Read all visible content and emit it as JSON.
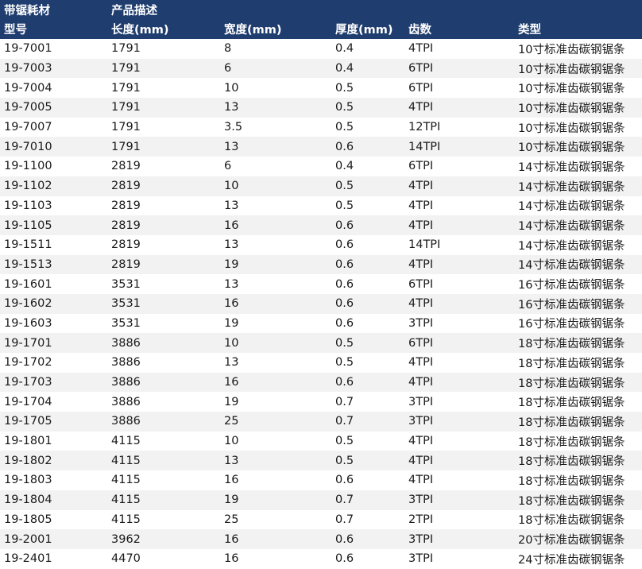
{
  "colors": {
    "header_bg": "#1f3d6e",
    "header_text": "#ffffff",
    "stripe": "#f2f2f2"
  },
  "table": {
    "group_header": {
      "col1": "带锯耗材",
      "col2": "产品描述"
    },
    "headers": [
      "型号",
      "长度(mm)",
      "宽度(mm)",
      "厚度(mm)",
      "齿数",
      "类型"
    ],
    "rows": [
      [
        "19-7001",
        "1791",
        "8",
        "0.4",
        "4TPI",
        "10寸标准齿碳钢锯条"
      ],
      [
        "19-7003",
        "1791",
        "6",
        "0.4",
        "6TPI",
        "10寸标准齿碳钢锯条"
      ],
      [
        "19-7004",
        "1791",
        "10",
        "0.5",
        "6TPI",
        "10寸标准齿碳钢锯条"
      ],
      [
        "19-7005",
        "1791",
        "13",
        "0.5",
        "4TPI",
        "10寸标准齿碳钢锯条"
      ],
      [
        "19-7007",
        "1791",
        "3.5",
        "0.5",
        "12TPI",
        "10寸标准齿碳钢锯条"
      ],
      [
        "19-7010",
        "1791",
        "13",
        "0.6",
        "14TPI",
        "10寸标准齿碳钢锯条"
      ],
      [
        "19-1100",
        "2819",
        "6",
        "0.4",
        "6TPI",
        "14寸标准齿碳钢锯条"
      ],
      [
        "19-1102",
        "2819",
        "10",
        "0.5",
        "4TPI",
        "14寸标准齿碳钢锯条"
      ],
      [
        "19-1103",
        "2819",
        "13",
        "0.5",
        "4TPI",
        "14寸标准齿碳钢锯条"
      ],
      [
        "19-1105",
        "2819",
        "16",
        "0.6",
        "4TPI",
        "14寸标准齿碳钢锯条"
      ],
      [
        "19-1511",
        "2819",
        "13",
        "0.6",
        "14TPI",
        "14寸标准齿碳钢锯条"
      ],
      [
        "19-1513",
        "2819",
        "19",
        "0.6",
        "4TPI",
        "14寸标准齿碳钢锯条"
      ],
      [
        "19-1601",
        "3531",
        "13",
        "0.6",
        "6TPI",
        "16寸标准齿碳钢锯条"
      ],
      [
        "19-1602",
        "3531",
        "16",
        "0.6",
        "4TPI",
        "16寸标准齿碳钢锯条"
      ],
      [
        "19-1603",
        "3531",
        "19",
        "0.6",
        "3TPI",
        "16寸标准齿碳钢锯条"
      ],
      [
        "19-1701",
        "3886",
        "10",
        "0.5",
        "6TPI",
        "18寸标准齿碳钢锯条"
      ],
      [
        "19-1702",
        "3886",
        "13",
        "0.5",
        "4TPI",
        "18寸标准齿碳钢锯条"
      ],
      [
        "19-1703",
        "3886",
        "16",
        "0.6",
        "4TPI",
        "18寸标准齿碳钢锯条"
      ],
      [
        "19-1704",
        "3886",
        "19",
        "0.7",
        "3TPI",
        "18寸标准齿碳钢锯条"
      ],
      [
        "19-1705",
        "3886",
        "25",
        "0.7",
        "3TPI",
        "18寸标准齿碳钢锯条"
      ],
      [
        "19-1801",
        "4115",
        "10",
        "0.5",
        "4TPI",
        "18寸标准齿碳钢锯条"
      ],
      [
        "19-1802",
        "4115",
        "13",
        "0.5",
        "4TPI",
        "18寸标准齿碳钢锯条"
      ],
      [
        "19-1803",
        "4115",
        "16",
        "0.6",
        "4TPI",
        "18寸标准齿碳钢锯条"
      ],
      [
        "19-1804",
        "4115",
        "19",
        "0.7",
        "3TPI",
        "18寸标准齿碳钢锯条"
      ],
      [
        "19-1805",
        "4115",
        "25",
        "0.7",
        "2TPI",
        "18寸标准齿碳钢锯条"
      ],
      [
        "19-2001",
        "3962",
        "16",
        "0.6",
        "3TPI",
        "20寸标准齿碳钢锯条"
      ],
      [
        "19-2401",
        "4470",
        "16",
        "0.6",
        "3TPI",
        "24寸标准齿碳钢锯条"
      ]
    ]
  }
}
